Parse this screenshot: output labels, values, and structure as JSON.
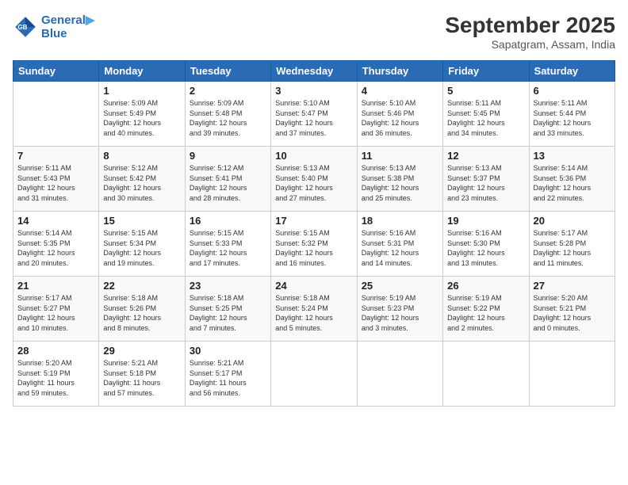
{
  "logo": {
    "line1": "General",
    "line2": "Blue"
  },
  "header": {
    "month": "September 2025",
    "location": "Sapatgram, Assam, India"
  },
  "weekdays": [
    "Sunday",
    "Monday",
    "Tuesday",
    "Wednesday",
    "Thursday",
    "Friday",
    "Saturday"
  ],
  "weeks": [
    [
      {
        "day": "",
        "info": ""
      },
      {
        "day": "1",
        "info": "Sunrise: 5:09 AM\nSunset: 5:49 PM\nDaylight: 12 hours\nand 40 minutes."
      },
      {
        "day": "2",
        "info": "Sunrise: 5:09 AM\nSunset: 5:48 PM\nDaylight: 12 hours\nand 39 minutes."
      },
      {
        "day": "3",
        "info": "Sunrise: 5:10 AM\nSunset: 5:47 PM\nDaylight: 12 hours\nand 37 minutes."
      },
      {
        "day": "4",
        "info": "Sunrise: 5:10 AM\nSunset: 5:46 PM\nDaylight: 12 hours\nand 36 minutes."
      },
      {
        "day": "5",
        "info": "Sunrise: 5:11 AM\nSunset: 5:45 PM\nDaylight: 12 hours\nand 34 minutes."
      },
      {
        "day": "6",
        "info": "Sunrise: 5:11 AM\nSunset: 5:44 PM\nDaylight: 12 hours\nand 33 minutes."
      }
    ],
    [
      {
        "day": "7",
        "info": "Sunrise: 5:11 AM\nSunset: 5:43 PM\nDaylight: 12 hours\nand 31 minutes."
      },
      {
        "day": "8",
        "info": "Sunrise: 5:12 AM\nSunset: 5:42 PM\nDaylight: 12 hours\nand 30 minutes."
      },
      {
        "day": "9",
        "info": "Sunrise: 5:12 AM\nSunset: 5:41 PM\nDaylight: 12 hours\nand 28 minutes."
      },
      {
        "day": "10",
        "info": "Sunrise: 5:13 AM\nSunset: 5:40 PM\nDaylight: 12 hours\nand 27 minutes."
      },
      {
        "day": "11",
        "info": "Sunrise: 5:13 AM\nSunset: 5:38 PM\nDaylight: 12 hours\nand 25 minutes."
      },
      {
        "day": "12",
        "info": "Sunrise: 5:13 AM\nSunset: 5:37 PM\nDaylight: 12 hours\nand 23 minutes."
      },
      {
        "day": "13",
        "info": "Sunrise: 5:14 AM\nSunset: 5:36 PM\nDaylight: 12 hours\nand 22 minutes."
      }
    ],
    [
      {
        "day": "14",
        "info": "Sunrise: 5:14 AM\nSunset: 5:35 PM\nDaylight: 12 hours\nand 20 minutes."
      },
      {
        "day": "15",
        "info": "Sunrise: 5:15 AM\nSunset: 5:34 PM\nDaylight: 12 hours\nand 19 minutes."
      },
      {
        "day": "16",
        "info": "Sunrise: 5:15 AM\nSunset: 5:33 PM\nDaylight: 12 hours\nand 17 minutes."
      },
      {
        "day": "17",
        "info": "Sunrise: 5:15 AM\nSunset: 5:32 PM\nDaylight: 12 hours\nand 16 minutes."
      },
      {
        "day": "18",
        "info": "Sunrise: 5:16 AM\nSunset: 5:31 PM\nDaylight: 12 hours\nand 14 minutes."
      },
      {
        "day": "19",
        "info": "Sunrise: 5:16 AM\nSunset: 5:30 PM\nDaylight: 12 hours\nand 13 minutes."
      },
      {
        "day": "20",
        "info": "Sunrise: 5:17 AM\nSunset: 5:28 PM\nDaylight: 12 hours\nand 11 minutes."
      }
    ],
    [
      {
        "day": "21",
        "info": "Sunrise: 5:17 AM\nSunset: 5:27 PM\nDaylight: 12 hours\nand 10 minutes."
      },
      {
        "day": "22",
        "info": "Sunrise: 5:18 AM\nSunset: 5:26 PM\nDaylight: 12 hours\nand 8 minutes."
      },
      {
        "day": "23",
        "info": "Sunrise: 5:18 AM\nSunset: 5:25 PM\nDaylight: 12 hours\nand 7 minutes."
      },
      {
        "day": "24",
        "info": "Sunrise: 5:18 AM\nSunset: 5:24 PM\nDaylight: 12 hours\nand 5 minutes."
      },
      {
        "day": "25",
        "info": "Sunrise: 5:19 AM\nSunset: 5:23 PM\nDaylight: 12 hours\nand 3 minutes."
      },
      {
        "day": "26",
        "info": "Sunrise: 5:19 AM\nSunset: 5:22 PM\nDaylight: 12 hours\nand 2 minutes."
      },
      {
        "day": "27",
        "info": "Sunrise: 5:20 AM\nSunset: 5:21 PM\nDaylight: 12 hours\nand 0 minutes."
      }
    ],
    [
      {
        "day": "28",
        "info": "Sunrise: 5:20 AM\nSunset: 5:19 PM\nDaylight: 11 hours\nand 59 minutes."
      },
      {
        "day": "29",
        "info": "Sunrise: 5:21 AM\nSunset: 5:18 PM\nDaylight: 11 hours\nand 57 minutes."
      },
      {
        "day": "30",
        "info": "Sunrise: 5:21 AM\nSunset: 5:17 PM\nDaylight: 11 hours\nand 56 minutes."
      },
      {
        "day": "",
        "info": ""
      },
      {
        "day": "",
        "info": ""
      },
      {
        "day": "",
        "info": ""
      },
      {
        "day": "",
        "info": ""
      }
    ]
  ]
}
